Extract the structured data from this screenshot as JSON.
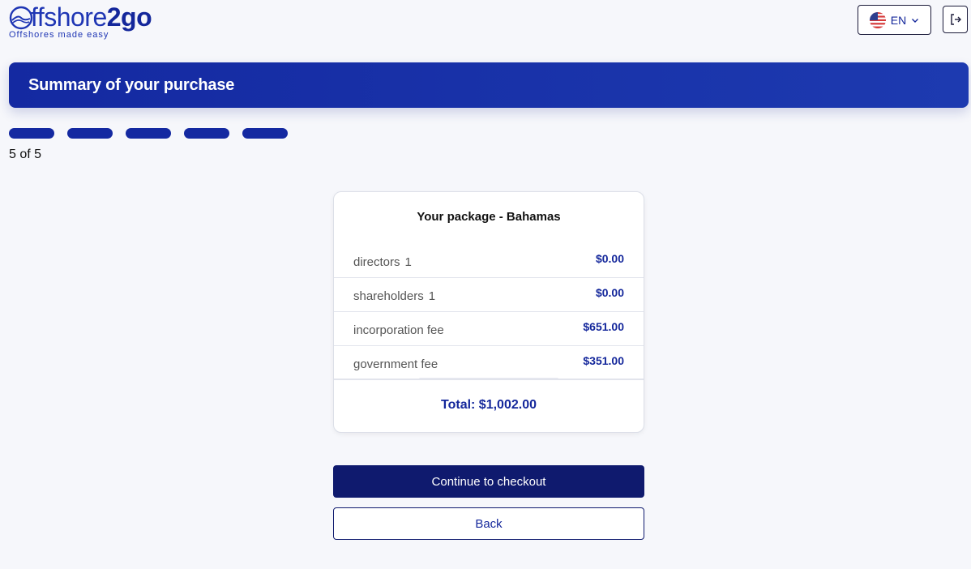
{
  "header": {
    "logo": {
      "text_light": "ffshore",
      "text_bold": "2go",
      "tagline": "Offshores made easy"
    },
    "language": {
      "label": "EN",
      "flag_icon": "us-flag-icon"
    },
    "logout_icon": "logout-icon"
  },
  "banner": {
    "title": "Summary of your purchase"
  },
  "progress": {
    "current": 5,
    "total": 5,
    "label": "5 of 5"
  },
  "package": {
    "title": "Your package - Bahamas",
    "items": [
      {
        "label": "directors",
        "qty": "1",
        "price": "$0.00"
      },
      {
        "label": "shareholders",
        "qty": "1",
        "price": "$0.00"
      },
      {
        "label": "incorporation fee",
        "qty": "",
        "price": "$651.00"
      },
      {
        "label": "government fee",
        "qty": "",
        "price": "$351.00"
      }
    ],
    "total": "Total: $1,002.00"
  },
  "actions": {
    "continue_label": "Continue to checkout",
    "back_label": "Back"
  },
  "colors": {
    "brand": "#14279b",
    "primary_button": "#0f1a6e",
    "background": "#f6f7fb"
  }
}
